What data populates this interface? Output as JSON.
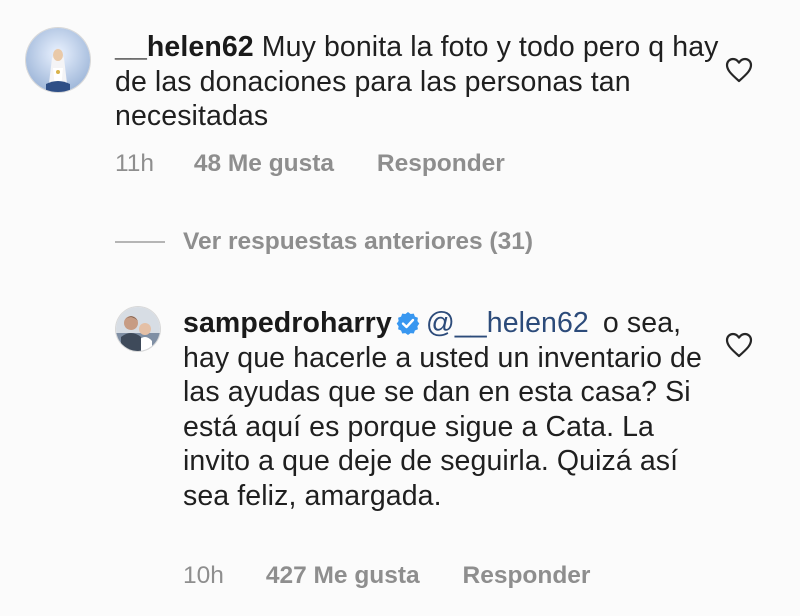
{
  "comments": [
    {
      "username": "__helen62",
      "text": "Muy bonita la foto y todo pero q hay de las donaciones para las personas tan necesitadas",
      "time": "11h",
      "likes": "48 Me gusta",
      "reply": "Responder"
    },
    {
      "username": "sampedroharry",
      "verified": true,
      "mention": "@__helen62",
      "text": "o sea, hay que hacerle a usted un inventario de las ayudas que se dan en esta casa? Si está aquí es porque sigue a Cata. La invito a que deje de seguirla. Quizá así sea feliz, amargada.",
      "time": "10h",
      "likes": "427 Me gusta",
      "reply": "Responder"
    }
  ],
  "view_previous": "Ver respuestas anteriores (31)",
  "icons": {
    "like": "heart-outline-icon",
    "verified": "verified-badge-icon"
  },
  "colors": {
    "verified": "#3897f0",
    "mention": "#2c4b7a",
    "meta": "#8e8e8e"
  }
}
